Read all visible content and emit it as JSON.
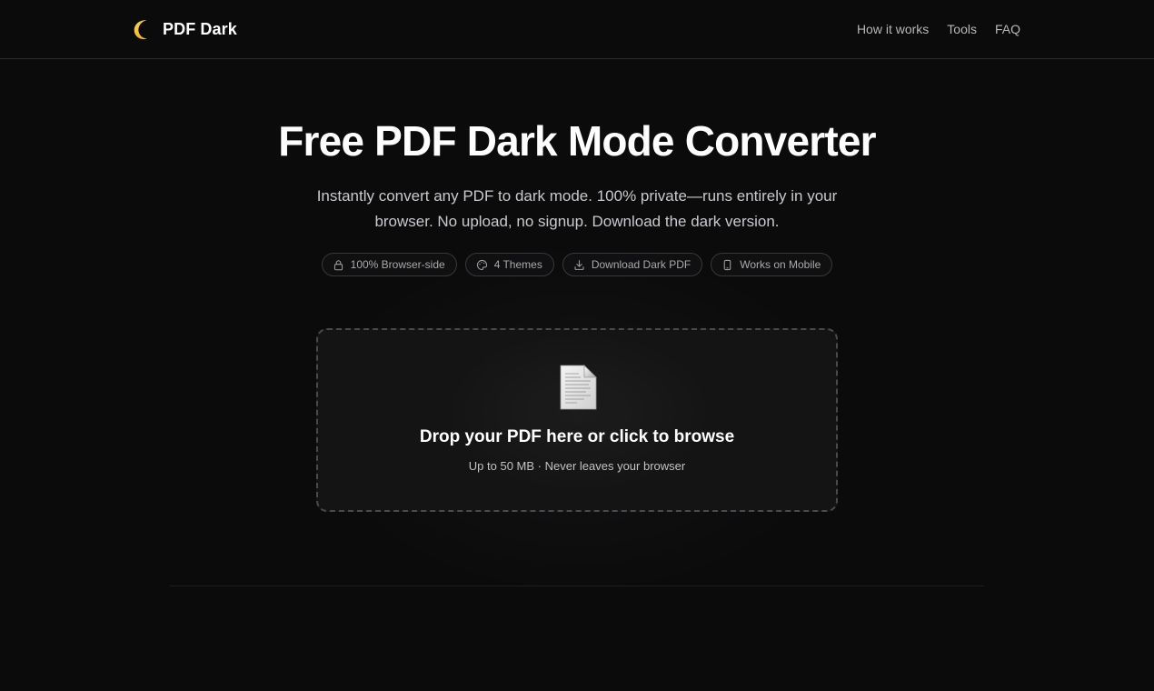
{
  "header": {
    "brand_icon": "crescent-moon-icon",
    "brand_name": "PDF Dark",
    "nav": [
      {
        "label": "How it works"
      },
      {
        "label": "Tools"
      },
      {
        "label": "FAQ"
      }
    ]
  },
  "hero": {
    "title": "Free PDF Dark Mode Converter",
    "subtitle_line1": "Instantly convert any PDF to dark mode. 100% private—runs entirely in your",
    "subtitle_line2": "browser. No upload, no signup. Download the dark version."
  },
  "features": [
    {
      "icon": "lock-icon",
      "label": "100% Browser-side"
    },
    {
      "icon": "palette-icon",
      "label": "4 Themes"
    },
    {
      "icon": "download-icon",
      "label": "Download Dark PDF"
    },
    {
      "icon": "mobile-phone-icon",
      "label": "Works on Mobile"
    }
  ],
  "dropzone": {
    "icon": "document-icon",
    "title": "Drop your PDF here or click to browse",
    "subtitle": "Up to 50 MB · Never leaves your browser"
  },
  "colors": {
    "background": "#0b0b0c",
    "dropzone_bg": "#141415",
    "border": "#38383c",
    "moon": "#f5c33b"
  }
}
